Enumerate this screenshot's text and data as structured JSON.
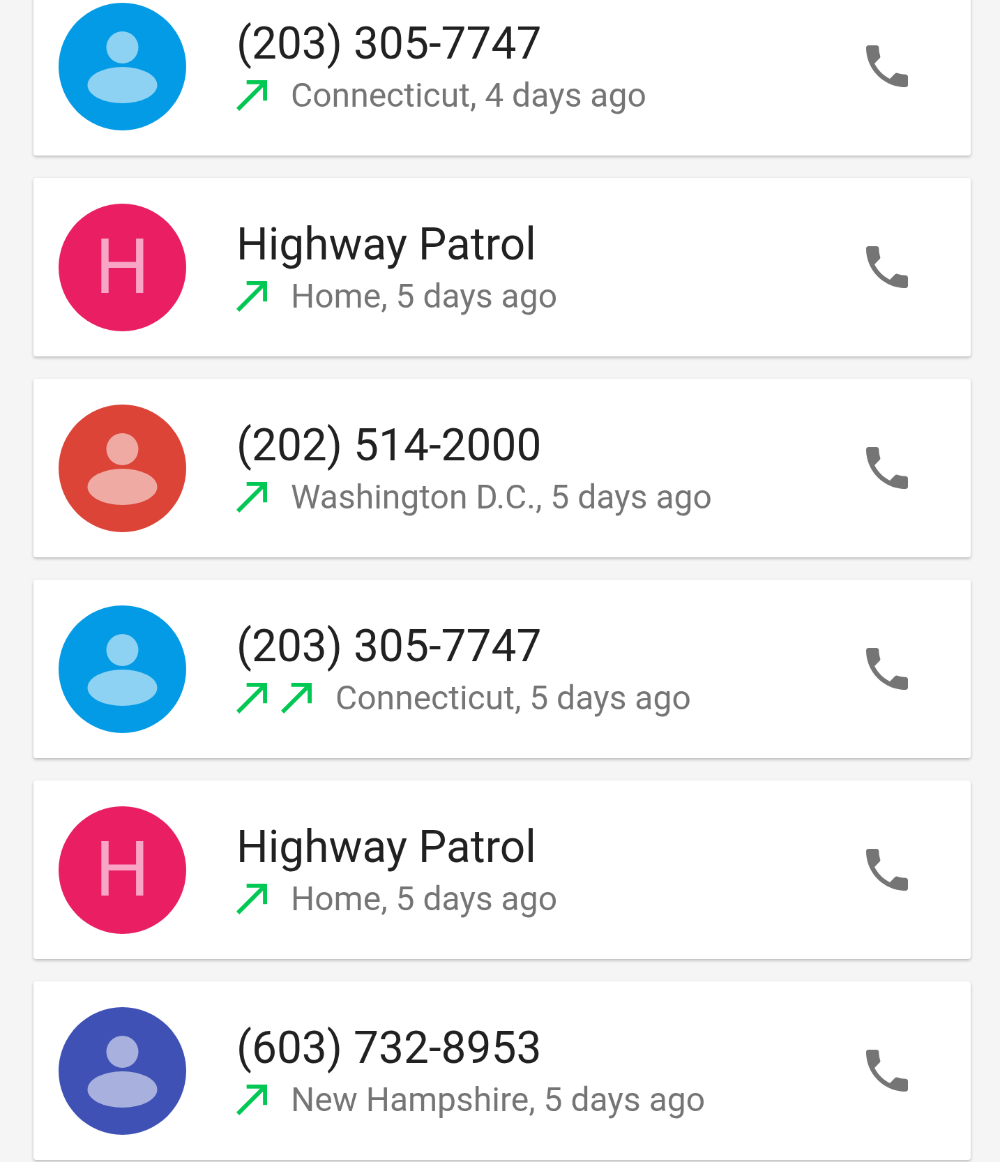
{
  "calls": [
    {
      "title": "(203) 305-7747",
      "avatar": {
        "kind": "person",
        "color": "#039be5"
      },
      "call_types": [
        {
          "kind": "outgoing"
        }
      ],
      "detail": "Connecticut, 4 days ago"
    },
    {
      "title": "Highway Patrol",
      "avatar": {
        "kind": "letter",
        "letter": "H",
        "color": "#e91e63"
      },
      "call_types": [
        {
          "kind": "outgoing"
        }
      ],
      "detail": "Home, 5 days ago"
    },
    {
      "title": "(202) 514-2000",
      "avatar": {
        "kind": "person",
        "color": "#db4437"
      },
      "call_types": [
        {
          "kind": "outgoing"
        }
      ],
      "detail": "Washington D.C., 5 days ago"
    },
    {
      "title": "(203) 305-7747",
      "avatar": {
        "kind": "person",
        "color": "#039be5"
      },
      "call_types": [
        {
          "kind": "outgoing"
        },
        {
          "kind": "outgoing"
        }
      ],
      "detail": "Connecticut, 5 days ago"
    },
    {
      "title": "Highway Patrol",
      "avatar": {
        "kind": "letter",
        "letter": "H",
        "color": "#e91e63"
      },
      "call_types": [
        {
          "kind": "outgoing"
        }
      ],
      "detail": "Home, 5 days ago"
    },
    {
      "title": "(603) 732-8953",
      "avatar": {
        "kind": "person",
        "color": "#3f51b5"
      },
      "call_types": [
        {
          "kind": "outgoing"
        }
      ],
      "detail": "New Hampshire, 5 days ago"
    }
  ]
}
